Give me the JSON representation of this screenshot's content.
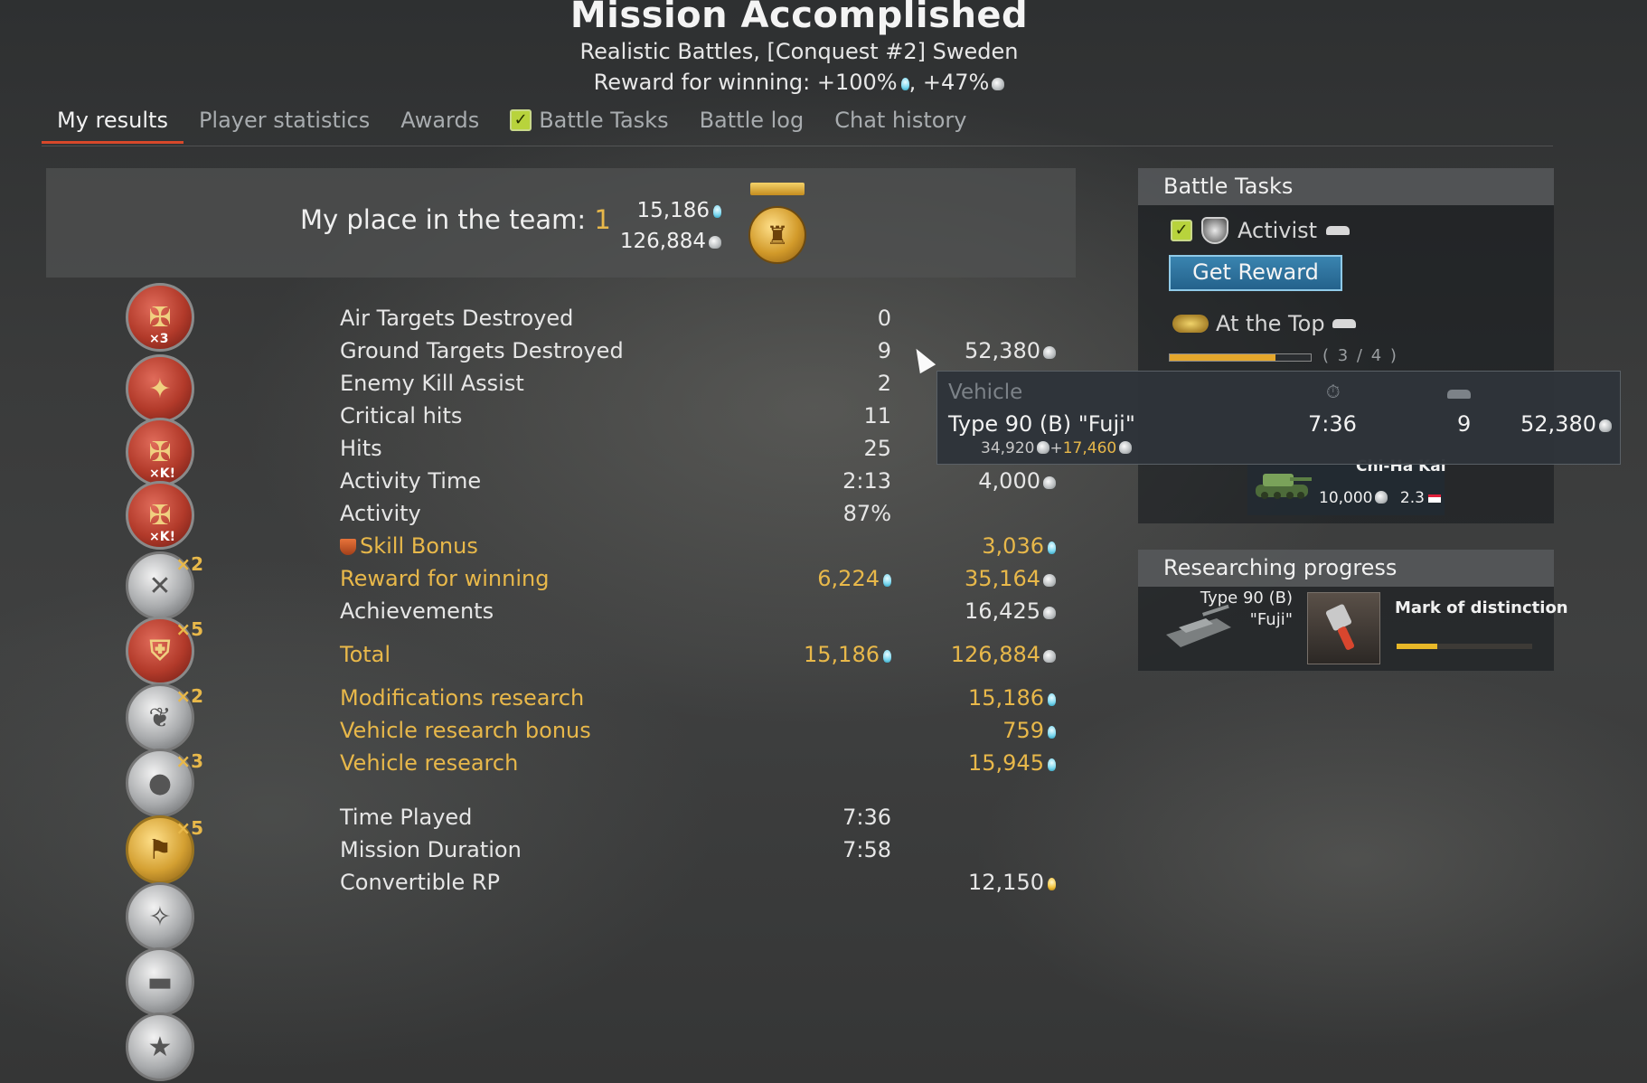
{
  "header": {
    "title": "Mission Accomplished",
    "subtitle": "Realistic Battles, [Conquest #2] Sweden",
    "reward_prefix": "Reward for winning: ",
    "reward_rp": "+100%",
    "reward_sep": ", ",
    "reward_sl": "+47%"
  },
  "tabs": [
    "My results",
    "Player statistics",
    "Awards",
    "Battle Tasks",
    "Battle log",
    "Chat history"
  ],
  "place": {
    "label": "My place in the team: ",
    "value": "1",
    "rp": "15,186",
    "sl": "126,884"
  },
  "awards": [
    {
      "icon": "ground-kills-x3-icon",
      "tag": "×3",
      "mult": ""
    },
    {
      "icon": "assist-icon",
      "tag": "",
      "mult": ""
    },
    {
      "icon": "ground-kills-xk-icon",
      "tag": "×K!",
      "mult": ""
    },
    {
      "icon": "ground-kills-xk-2-icon",
      "tag": "×K!",
      "mult": ""
    },
    {
      "icon": "crossed-swords-icon",
      "tag": "",
      "mult": "×2"
    },
    {
      "icon": "red-shield-icon",
      "tag": "",
      "mult": "×5"
    },
    {
      "icon": "eagle-icon",
      "tag": "",
      "mult": "×2"
    },
    {
      "icon": "bomb-icon",
      "tag": "",
      "mult": "×3"
    },
    {
      "icon": "gold-flag-icon",
      "tag": "",
      "mult": "×5"
    },
    {
      "icon": "wreath-icon",
      "tag": "",
      "mult": ""
    },
    {
      "icon": "tank-medal-icon",
      "tag": "",
      "mult": ""
    },
    {
      "icon": "star-medal-icon",
      "tag": "",
      "mult": ""
    }
  ],
  "stats": {
    "air": {
      "label": "Air Targets Destroyed",
      "v1": "0",
      "v2": ""
    },
    "ground": {
      "label": "Ground Targets Destroyed",
      "v1": "9",
      "v2": "52,380"
    },
    "assist": {
      "label": "Enemy Kill Assist",
      "v1": "2",
      "v2": ""
    },
    "crit": {
      "label": "Critical hits",
      "v1": "11",
      "v2": ""
    },
    "hits": {
      "label": "Hits",
      "v1": "25",
      "v2": ""
    },
    "acttime": {
      "label": "Activity Time",
      "v1": "2:13",
      "v2": "4,000"
    },
    "activity": {
      "label": "Activity",
      "v1": "87%",
      "v2": ""
    },
    "skill": {
      "label": "Skill Bonus",
      "v1": "",
      "v2": "3,036"
    },
    "winning": {
      "label": "Reward for winning",
      "v1": "6,224",
      "v2": "35,164"
    },
    "ach": {
      "label": "Achievements",
      "v1": "",
      "v2": "16,425"
    },
    "total": {
      "label": "Total",
      "v1": "15,186",
      "v2": "126,884"
    },
    "mods": {
      "label": "Modifications research",
      "v1": "",
      "v2": "15,186"
    },
    "vrb": {
      "label": "Vehicle research bonus",
      "v1": "",
      "v2": "759"
    },
    "vr": {
      "label": "Vehicle research",
      "v1": "",
      "v2": "15,945"
    },
    "played": {
      "label": "Time Played",
      "v1": "7:36",
      "v2": ""
    },
    "duration": {
      "label": "Mission Duration",
      "v1": "7:58",
      "v2": ""
    },
    "crp": {
      "label": "Convertible RP",
      "v1": "",
      "v2": "12,150"
    }
  },
  "battle_tasks": {
    "title": "Battle Tasks",
    "task1": "Activist",
    "get_reward": "Get Reward",
    "task2": "At the Top",
    "progress_text": "( 3 / 4 )",
    "progress": 0.75
  },
  "vehicle_card": {
    "name": "Chi-Ha Kai",
    "sl": "10,000",
    "br": "2.3"
  },
  "tooltip": {
    "head_vehicle": "Vehicle",
    "vehicle": "Type 90 (B) \"Fuji\"",
    "time": "7:36",
    "kills": "9",
    "reward": "52,380",
    "sub_base": "34,920",
    "sub_plus": "+",
    "sub_bonus": "17,460"
  },
  "research": {
    "title": "Researching progress",
    "vehicle_line1": "Type 90 (B)",
    "vehicle_line2": "\"Fuji\"",
    "item": "Mark of distinction",
    "progress": 0.3
  }
}
